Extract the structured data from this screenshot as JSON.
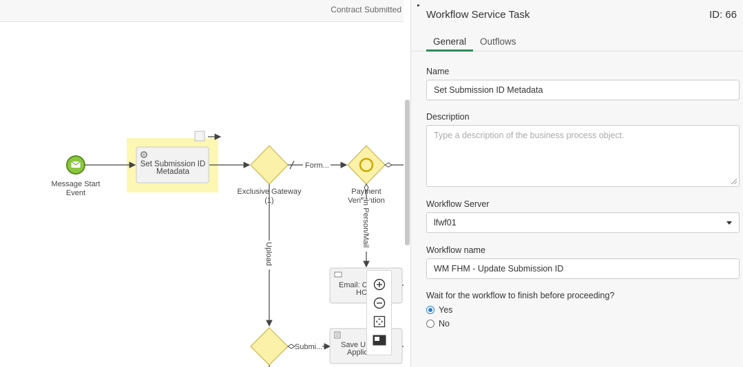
{
  "canvas": {
    "header_label": "Contract Submitted",
    "nodes": {
      "start_event": {
        "line1": "Message Start",
        "line2": "Event"
      },
      "task_set_submission": {
        "line1": "Set Submission ID",
        "line2": "Metadata"
      },
      "gateway_exclusive": {
        "line1": "Exclusive Gateway",
        "line2": "(1)"
      },
      "event_payment": {
        "line1": "Payment",
        "line2": "Verification"
      },
      "task_email": {
        "line1": "Email: C",
        "line2": "HC"
      },
      "task_save": {
        "line1": "Save U",
        "line2": "Applic"
      }
    },
    "flows": {
      "form": "Form...",
      "upload": "Upload",
      "in_person": "In Person/Mail",
      "submit": "Submi..."
    }
  },
  "zoom_toolbar": {
    "zoom_in_icon": "plus-circle",
    "zoom_out_icon": "minus-circle",
    "fit_icon": "fit-screen",
    "minimap_icon": "minimap"
  },
  "panel": {
    "title": "Workflow Service Task",
    "id_label": "ID: 66",
    "tabs": [
      {
        "label": "General",
        "active": true
      },
      {
        "label": "Outflows",
        "active": false
      }
    ],
    "fields": {
      "name": {
        "label": "Name",
        "value": "Set Submission ID Metadata"
      },
      "description": {
        "label": "Description",
        "value": "",
        "placeholder": "Type a description of the business process object."
      },
      "workflow_server": {
        "label": "Workflow Server",
        "value": "lfwf01"
      },
      "workflow_name": {
        "label": "Workflow name",
        "value": "WM FHM - Update Submission ID"
      }
    },
    "wait_question": "Wait for the workflow to finish before proceeding?",
    "wait_options": [
      {
        "label": "Yes",
        "checked": true
      },
      {
        "label": "No",
        "checked": false
      }
    ]
  },
  "colors": {
    "accent_green": "#2e8b57",
    "radio_blue": "#2b7fd6",
    "selection_yellow": "#fdf7b4",
    "gateway_fill": "#fcf1a8",
    "gateway_stroke": "#c9b54a",
    "start_event_fill": "#8cc63f"
  }
}
